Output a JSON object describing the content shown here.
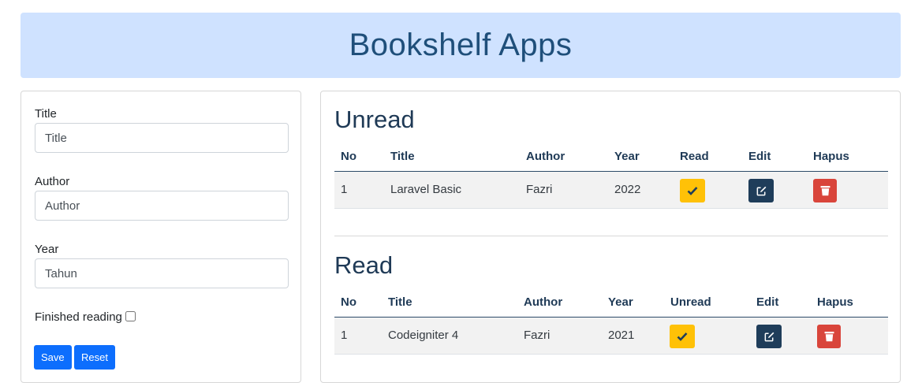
{
  "header": {
    "title": "Bookshelf Apps"
  },
  "form": {
    "title_label": "Title",
    "title_placeholder": "Title",
    "author_label": "Author",
    "author_placeholder": "Author",
    "year_label": "Year",
    "year_placeholder": "Tahun",
    "finished_label": "Finished reading",
    "finished_checked": false,
    "save_label": "Save",
    "reset_label": "Reset"
  },
  "unread": {
    "heading": "Unread",
    "columns": [
      "No",
      "Title",
      "Author",
      "Year",
      "Read",
      "Edit",
      "Hapus"
    ],
    "rows": [
      {
        "no": "1",
        "title": "Laravel Basic",
        "author": "Fazri",
        "year": "2022"
      }
    ]
  },
  "read": {
    "heading": "Read",
    "columns": [
      "No",
      "Title",
      "Author",
      "Year",
      "Unread",
      "Edit",
      "Hapus"
    ],
    "rows": [
      {
        "no": "1",
        "title": "Codeigniter 4",
        "author": "Fazri",
        "year": "2021"
      }
    ]
  },
  "icons": {
    "toggle": "check-icon",
    "edit": "edit-icon",
    "delete": "trash-icon"
  },
  "colors": {
    "header_bg": "#cfe2ff",
    "primary": "#0d6efd",
    "warning": "#ffc107",
    "dark": "#1f3d5a",
    "danger": "#d9453b"
  }
}
